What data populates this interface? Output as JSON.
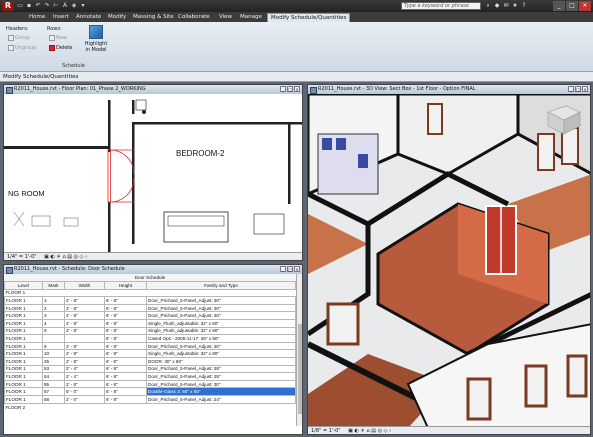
{
  "titlebar": {
    "app_letter": "R",
    "search_placeholder": "Type a keyword or phrase",
    "minimize": "_",
    "restore": "□",
    "close": "✕"
  },
  "tabs": [
    "Home",
    "Insert",
    "Annotate",
    "Modify",
    "Massing & Site",
    "Collaborate",
    "View",
    "Manage",
    "Modify Schedule/Quantities"
  ],
  "ribbon": {
    "headers_label": "Headers:",
    "group_label": "Group",
    "ungroup_label": "Ungroup",
    "rows_label": "Rows:",
    "new_label": "New",
    "delete_label": "Delete",
    "highlight_label": "Highlight in Model",
    "schedule_group": "Schedule"
  },
  "options_bar": "Modify Schedule/Quantities",
  "floorplan": {
    "title": "R2011_House.rvt - Floor Plan: 01_Phase 2_WORKING",
    "room_bedroom": "BEDROOM-2",
    "room_living": "NG ROOM",
    "scale": "1/4\" = 1'-0\""
  },
  "view3d": {
    "title": "R2011_House.rvt - 3D View: Sect Box - 1st Floor - Option FINAL",
    "scale": "1/8\" = 1'-0\""
  },
  "schedule": {
    "title": "R2011_House.rvt - Schedule: Door Schedule",
    "caption": "Door Schedule",
    "columns": [
      "Level",
      "Mark",
      "Width",
      "Height",
      "Family and Type"
    ],
    "group_header": "FLOOR 1",
    "rows": [
      [
        "FLOOR 1",
        "1",
        "2' - 8\"",
        "6' - 8\"",
        "Door_Prichard_5-Panel_Adjust: 30\""
      ],
      [
        "FLOOR 1",
        "2",
        "2' - 8\"",
        "6' - 8\"",
        "Door_Prichard_5-Panel_Adjust: 30\""
      ],
      [
        "FLOOR 1",
        "3",
        "2' - 8\"",
        "6' - 8\"",
        "Door_Prichard_5-Panel_Adjust: 30\""
      ],
      [
        "FLOOR 1",
        "4",
        "2' - 8\"",
        "6' - 8\"",
        "Single_Flush_adjustable: 32\" x 80\""
      ],
      [
        "FLOOR 1",
        "5",
        "2' - 8\"",
        "6' - 8\"",
        "Single_Flush_adjustable: 32\" x 80\""
      ],
      [
        "FLOOR 1",
        "",
        "",
        "6' - 8\"",
        "Cased Ops - 2005-11-17: 36\" x 80\""
      ],
      [
        "FLOOR 1",
        "9",
        "2' - 8\"",
        "6' - 8\"",
        "Door_Prichard_5-Panel_Adjust: 30\""
      ],
      [
        "FLOOR 1",
        "10",
        "2' - 8\"",
        "6' - 8\"",
        "Single_Flush_adjustable: 32\" x 80\""
      ],
      [
        "FLOOR 1",
        "25",
        "2' - 8\"",
        "6' - 8\"",
        "DOOR: 30\" x 80\""
      ],
      [
        "FLOOR 1",
        "53",
        "2' - 4\"",
        "6' - 8\"",
        "Door_Prichard_5-Panel_Adjust: 28\""
      ],
      [
        "FLOOR 1",
        "54",
        "2' - 4\"",
        "6' - 8\"",
        "Door_Prichard_5-Panel_Adjust: 28\""
      ],
      [
        "FLOOR 1",
        "55",
        "2' - 8\"",
        "6' - 8\"",
        "Door_Prichard_5-Panel_Adjust: 30\""
      ],
      [
        "FLOOR 1",
        "57",
        "5' - 0\"",
        "6' - 8\"",
        "Double-Glass 3: 60\" x 80\""
      ],
      [
        "FLOOR 1",
        "58",
        "2' - 0\"",
        "6' - 8\"",
        "Door_Prichard_5-Panel_Adjust: 24\""
      ]
    ],
    "footer_group": "FLOOR 2"
  }
}
